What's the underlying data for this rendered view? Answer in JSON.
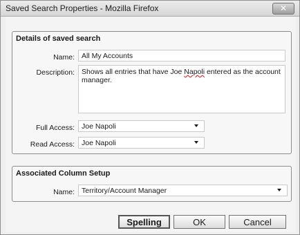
{
  "window": {
    "title": "Saved Search Properties - Mozilla Firefox",
    "close_label": "✕"
  },
  "details": {
    "heading": "Details of saved search",
    "name_label": "Name:",
    "name_value": "All My Accounts",
    "description_label": "Description:",
    "description_value_prefix": "Shows all entries that have Joe ",
    "description_value_misspelled": "Napoli",
    "description_value_suffix": " entered as the account manager.",
    "full_access_label": "Full Access:",
    "full_access_value": "Joe Napoli",
    "read_access_label": "Read Access:",
    "read_access_value": "Joe Napoli"
  },
  "column_setup": {
    "heading": "Associated Column Setup",
    "name_label": "Name:",
    "name_value": "Territory/Account Manager"
  },
  "buttons": {
    "spelling": "Spelling",
    "ok": "OK",
    "cancel": "Cancel"
  }
}
